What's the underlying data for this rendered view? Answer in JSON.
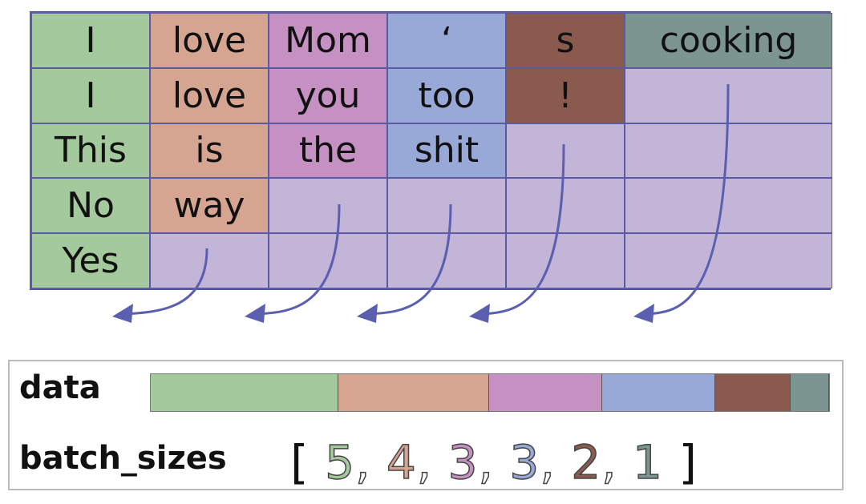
{
  "colors": {
    "col0": "#a3c99d",
    "col1": "#d5a592",
    "col2": "#c591c3",
    "col3": "#98a9d8",
    "col4": "#8a5a4e",
    "col5": "#7c9590",
    "pad": "#c3b5d8",
    "border": "#5a5aa0",
    "arrow": "#5a5fb0"
  },
  "rows": [
    [
      "I",
      "love",
      "Mom",
      "‘",
      "s",
      "cooking"
    ],
    [
      "I",
      "love",
      "you",
      "too",
      "!",
      ""
    ],
    [
      "This",
      "is",
      "the",
      "shit",
      "",
      ""
    ],
    [
      "No",
      "way",
      "",
      "",
      "",
      ""
    ],
    [
      "Yes",
      "",
      "",
      "",
      "",
      ""
    ]
  ],
  "data_label": "data",
  "batch_sizes_label": "batch_sizes",
  "batch_sizes": [
    5,
    4,
    3,
    3,
    2,
    1
  ],
  "bracket_open": "[",
  "bracket_close": "]"
}
